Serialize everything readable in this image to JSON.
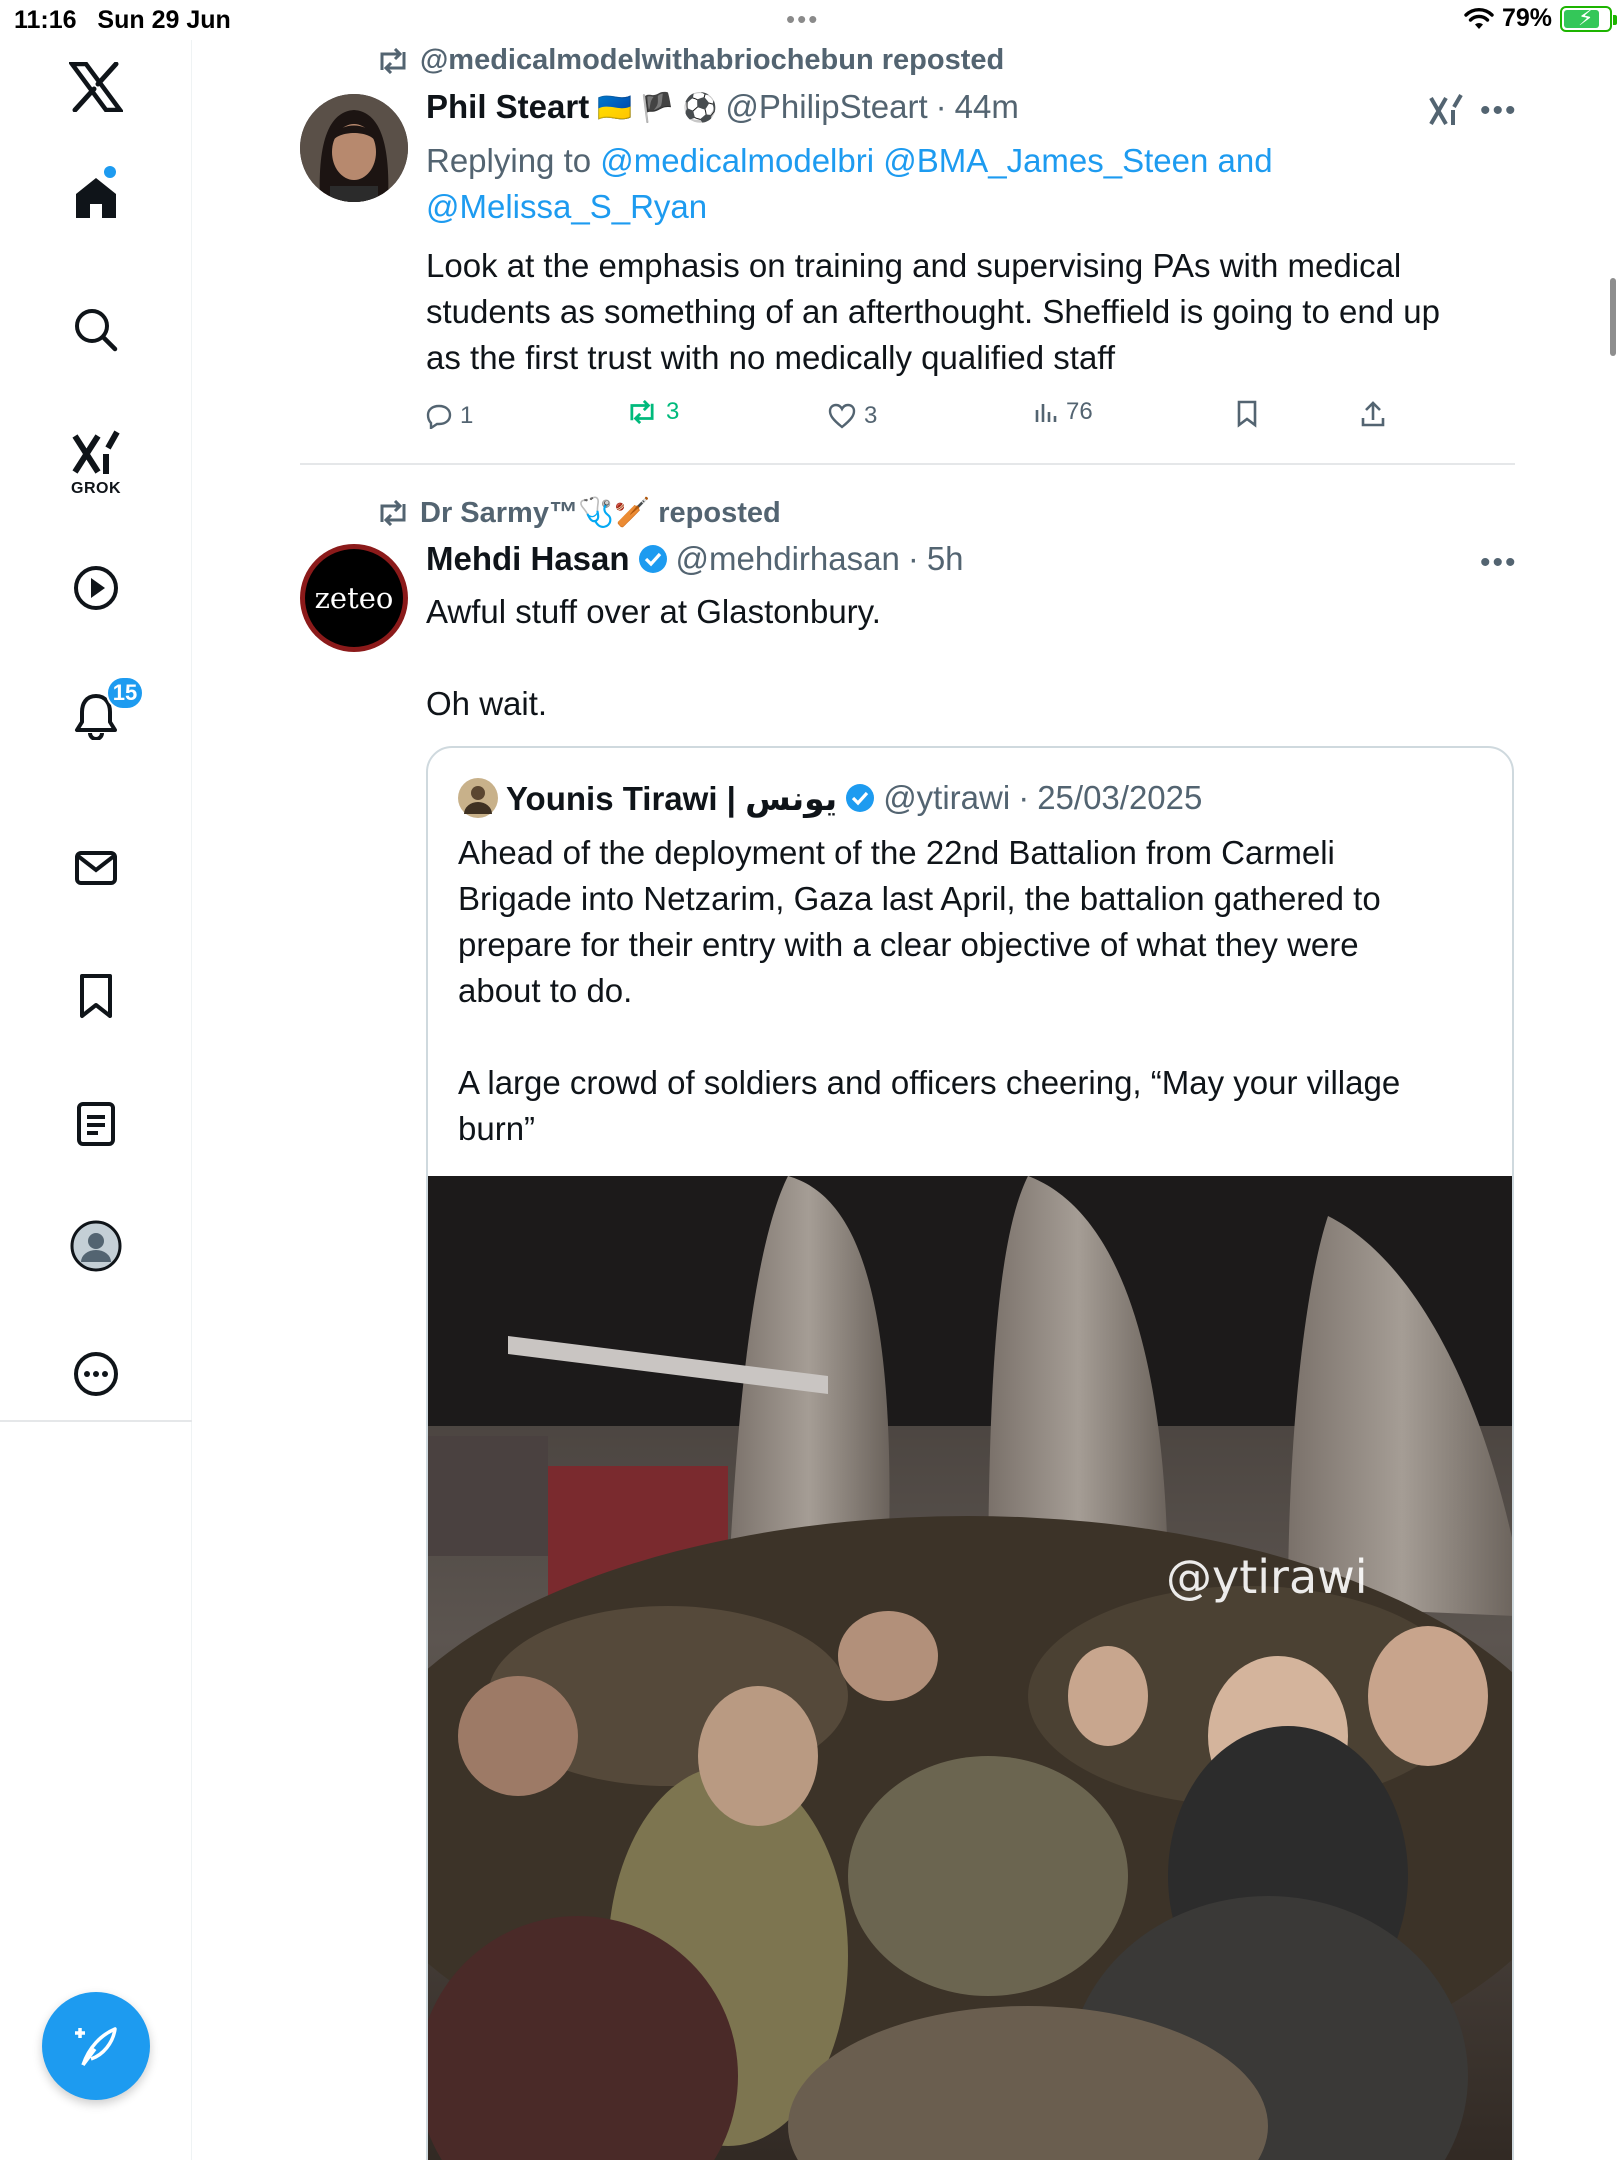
{
  "status_bar": {
    "time": "11:16",
    "date": "Sun 29 Jun",
    "battery_pct": "79%",
    "multitask": "•••"
  },
  "sidebar": {
    "items": [
      {
        "name": "x-logo"
      },
      {
        "name": "home"
      },
      {
        "name": "search"
      },
      {
        "name": "grok",
        "label": "GROK"
      },
      {
        "name": "video"
      },
      {
        "name": "notifications",
        "badge": "15"
      },
      {
        "name": "messages"
      },
      {
        "name": "bookmarks"
      },
      {
        "name": "lists"
      },
      {
        "name": "profile"
      },
      {
        "name": "more"
      }
    ],
    "accent": "#1d9bf0"
  },
  "tweet1": {
    "reposted_by": "@medicalmodelwithabriochebun reposted",
    "name": "Phil Steart",
    "flags": "🇺🇦 🏴 ⚽",
    "handle": "@PhilipSteart",
    "sep": "·",
    "time": "44m",
    "replying_label": "Replying to",
    "replying_to": "@medicalmodelbri @BMA_James_Steen and",
    "replying_to_2": "@Melissa_S_Ryan",
    "text": "Look at the emphasis on training and supervising PAs with medical\nstudents as something of an afterthought. Sheffield is going to end up\nas the first trust with no medically qualified staff",
    "replies": "1",
    "reposts": "3",
    "likes": "3",
    "views": "76"
  },
  "tweet2": {
    "reposted_by": "Dr Sarmy™🩺🏏 reposted",
    "avatar_text": "zeteo",
    "name": "Mehdi Hasan",
    "handle": "@mehdirhasan",
    "sep": "·",
    "time": "5h",
    "text": "Awful stuff over at Glastonbury.\n\nOh wait.",
    "quote": {
      "name": "Younis Tirawi | يونس",
      "handle": "@ytirawi",
      "sep": "·",
      "date": "25/03/2025",
      "text": "Ahead of the deployment of the 22nd Battalion from Carmeli\nBrigade into Netzarim, Gaza last April, the battalion gathered to\nprepare for their entry with a clear objective of what they were\nabout to do.\n\nA large crowd of soldiers and officers cheering, “May your village\nburn”",
      "watermark": "@ytirawi"
    }
  }
}
